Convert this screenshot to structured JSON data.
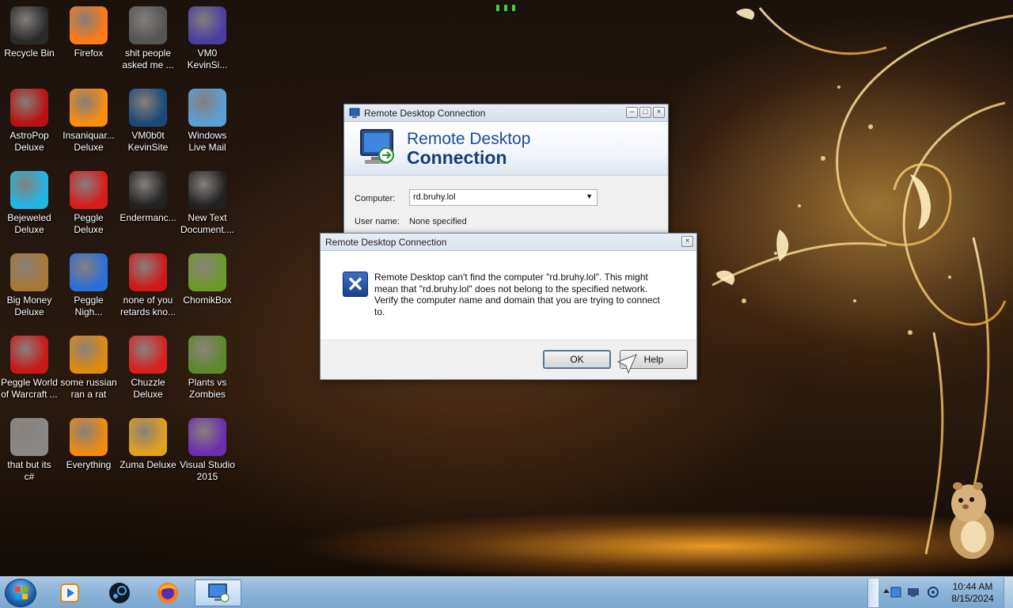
{
  "desktop_icons": [
    {
      "label": "Recycle Bin",
      "icon": "recycle-bin-icon",
      "color": "#2a2a2a"
    },
    {
      "label": "Firefox",
      "icon": "firefox-icon",
      "color": "#ff7a18"
    },
    {
      "label": "shit people\nasked me ...",
      "icon": "folder-icon",
      "color": "#555"
    },
    {
      "label": "VM0\nKevinSi...",
      "icon": "vm-firefox-icon",
      "color": "#4a3ea0"
    },
    {
      "label": "AstroPop\nDeluxe",
      "icon": "astropop-icon",
      "color": "#b11"
    },
    {
      "label": "Insaniquar...\nDeluxe",
      "icon": "insaniquarium-fish-icon",
      "color": "#ff8c10"
    },
    {
      "label": "VM0b0t\nKevinSite",
      "icon": "vmware-icon",
      "color": "#1b4a7a"
    },
    {
      "label": "Windows\nLive Mail",
      "icon": "live-mail-icon",
      "color": "#5aa0d8"
    },
    {
      "label": "Bejeweled\nDeluxe",
      "icon": "bejeweled-gem-icon",
      "color": "#1fb8e6"
    },
    {
      "label": "Peggle\nDeluxe",
      "icon": "peggle-icon",
      "color": "#d81b1b"
    },
    {
      "label": "Endermanc...",
      "icon": "text-file-dark-icon",
      "color": "#222"
    },
    {
      "label": "New Text\nDocument....",
      "icon": "text-document-icon",
      "color": "#222"
    },
    {
      "label": "Big Money\nDeluxe",
      "icon": "money-bag-icon",
      "color": "#a87838"
    },
    {
      "label": "Peggle\nNigh...",
      "icon": "peggle-nights-icon",
      "color": "#2a6fd8"
    },
    {
      "label": "none of you\nretards kno...",
      "icon": "red-dragon-icon",
      "color": "#d01818"
    },
    {
      "label": "ChomikBox",
      "icon": "chomikbox-hamster-icon",
      "color": "#6a9a2a"
    },
    {
      "label": "Peggle World\nof Warcraft ...",
      "icon": "peggle-wow-icon",
      "color": "#c81818"
    },
    {
      "label": "some russian\nran a rat",
      "icon": "dev-de-icon",
      "color": "#e08a10"
    },
    {
      "label": "Chuzzle\nDeluxe",
      "icon": "chuzzle-icon",
      "color": "#d82020"
    },
    {
      "label": "Plants vs\nZombies",
      "icon": "plants-vs-zombies-icon",
      "color": "#5a8a2a"
    },
    {
      "label": "that but its\nc#",
      "icon": "copy-windows-icon",
      "color": "#888"
    },
    {
      "label": "Everything",
      "icon": "magnifier-icon",
      "color": "#f08a10"
    },
    {
      "label": "Zuma Deluxe",
      "icon": "zuma-icon",
      "color": "#e0a020"
    },
    {
      "label": "Visual Studio\n2015",
      "icon": "visual-studio-icon",
      "color": "#6a2fb0"
    }
  ],
  "rdc_window": {
    "title": "Remote Desktop Connection",
    "banner_line1": "Remote Desktop",
    "banner_line2": "Connection",
    "computer_label": "Computer:",
    "computer_value": "rd.bruhy.lol",
    "username_label": "User name:",
    "username_value": "None specified"
  },
  "error_dialog": {
    "title": "Remote Desktop Connection",
    "message": "Remote Desktop can't find the computer \"rd.bruhy.lol\". This might mean that \"rd.bruhy.lol\" does not belong to the specified network. Verify the computer name and domain that you are trying to connect to.",
    "ok_label": "OK",
    "help_label": "Help"
  },
  "taskbar": {
    "pinned": [
      "media-player-icon",
      "steam-icon",
      "firefox-icon",
      "remote-desktop-icon"
    ],
    "time": "10:44 AM",
    "date": "8/15/2024"
  },
  "colors": {
    "taskbar": "#8db5d9",
    "banner_text": "#1b4f8c"
  }
}
